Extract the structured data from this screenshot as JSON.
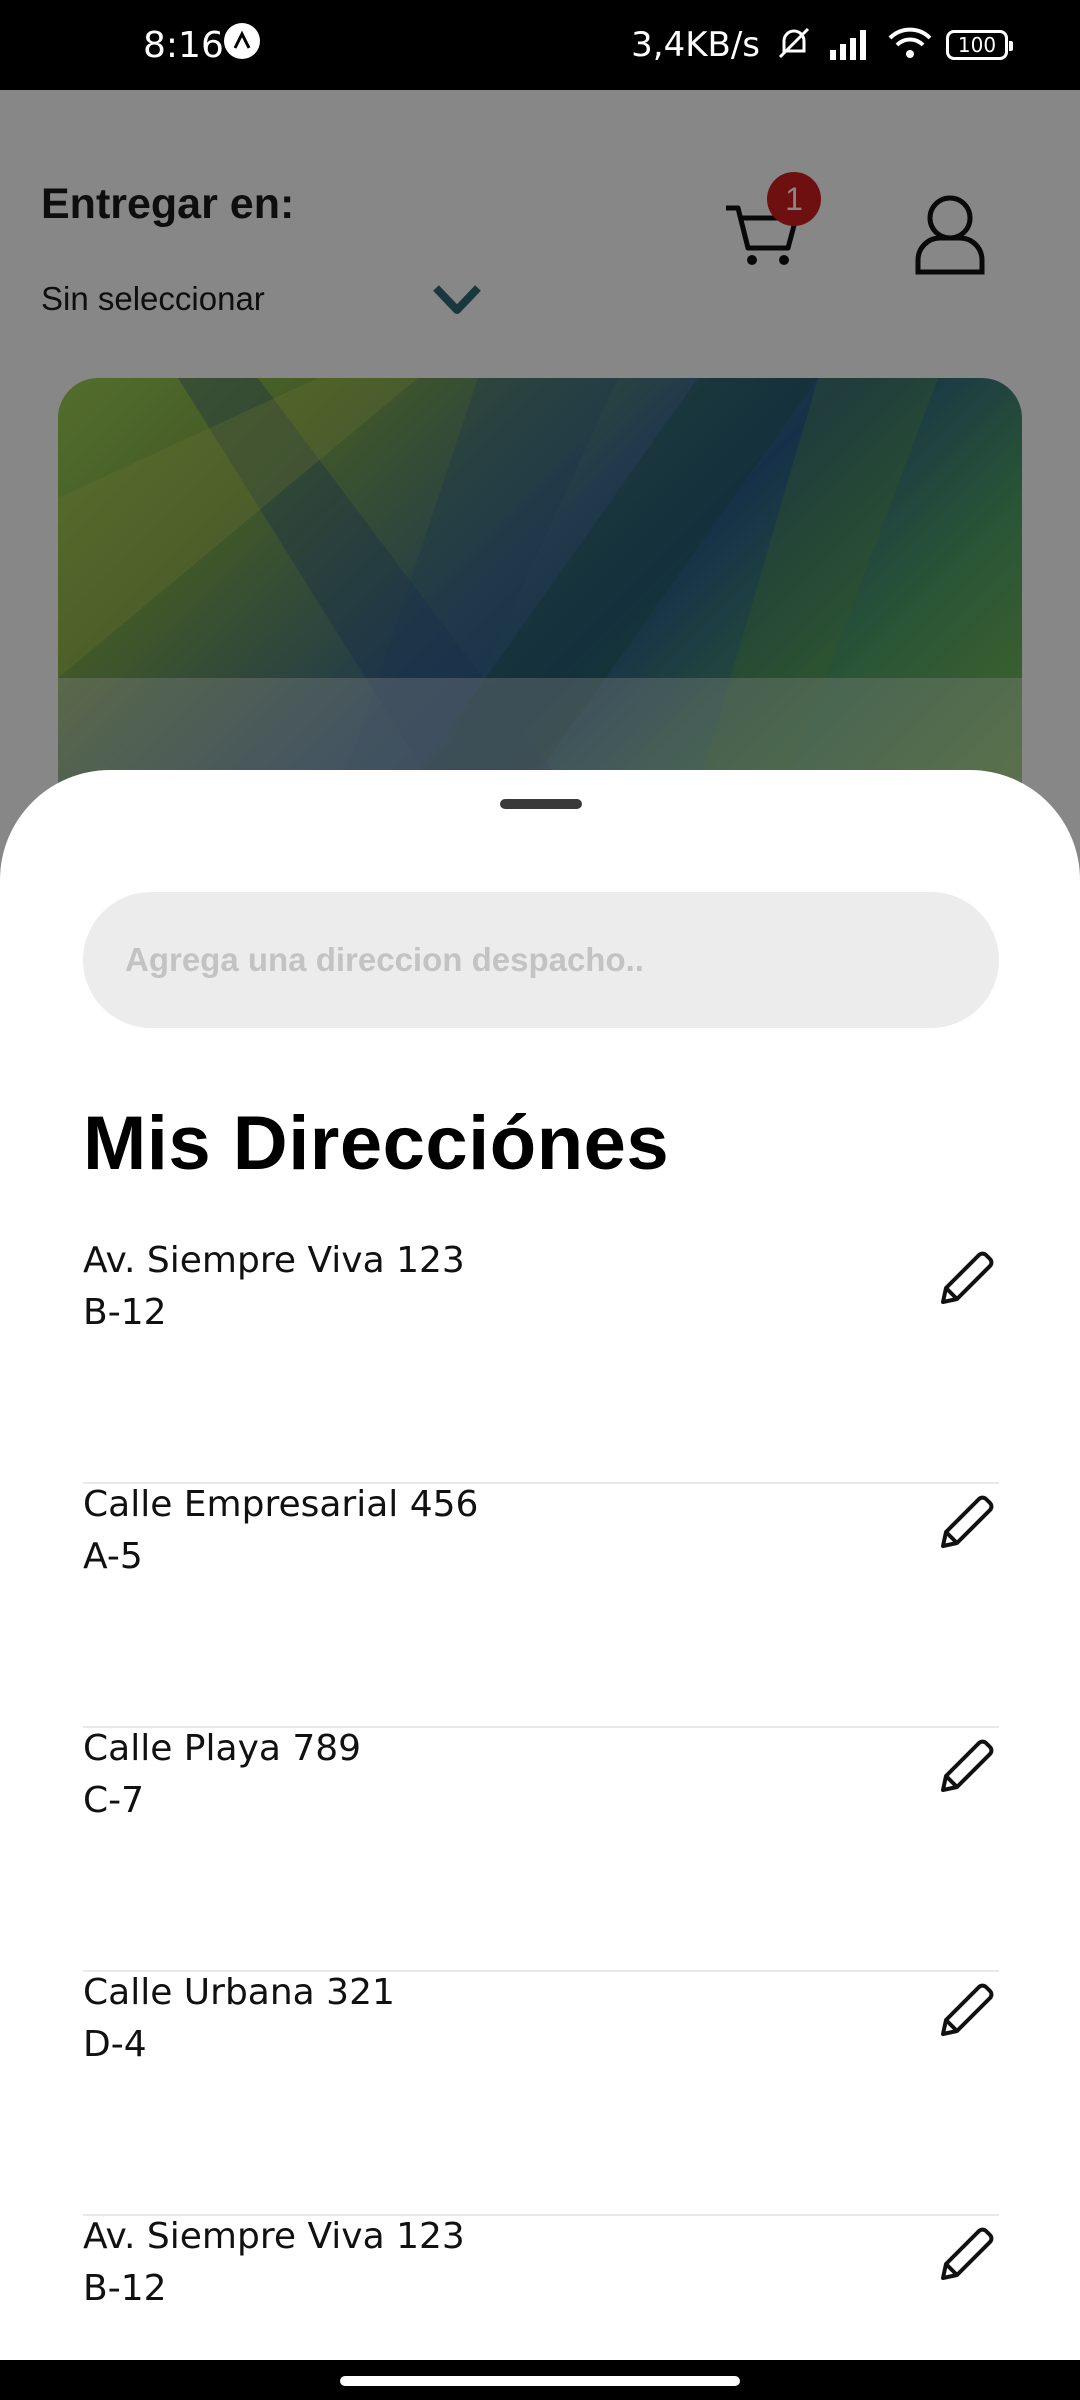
{
  "status_bar": {
    "time": "8:16",
    "net_speed": "3,4KB/s",
    "battery": "100"
  },
  "header": {
    "deliver_label": "Entregar en:",
    "deliver_value": "Sin seleccionar",
    "cart_count": "1"
  },
  "sheet": {
    "search_placeholder": "Agrega una direccion despacho..",
    "title": "Mis Direcciónes",
    "addresses": [
      {
        "line1": "Av. Siempre Viva 123",
        "line2": "B-12"
      },
      {
        "line1": "Calle Empresarial 456",
        "line2": "A-5"
      },
      {
        "line1": "Calle Playa 789",
        "line2": "C-7"
      },
      {
        "line1": "Calle Urbana 321",
        "line2": "D-4"
      },
      {
        "line1": "Av. Siempre Viva 123",
        "line2": "B-12"
      }
    ]
  },
  "icons": {
    "cart": "cart-icon",
    "profile": "user-icon",
    "dropdown": "chevron-down-icon",
    "edit": "pencil-icon",
    "mute": "bell-off-icon",
    "signal": "signal-icon",
    "wifi": "wifi-icon"
  },
  "colors": {
    "badge": "#d21f1f",
    "chevron": "#2f6b75",
    "search_bg": "#ececec"
  }
}
